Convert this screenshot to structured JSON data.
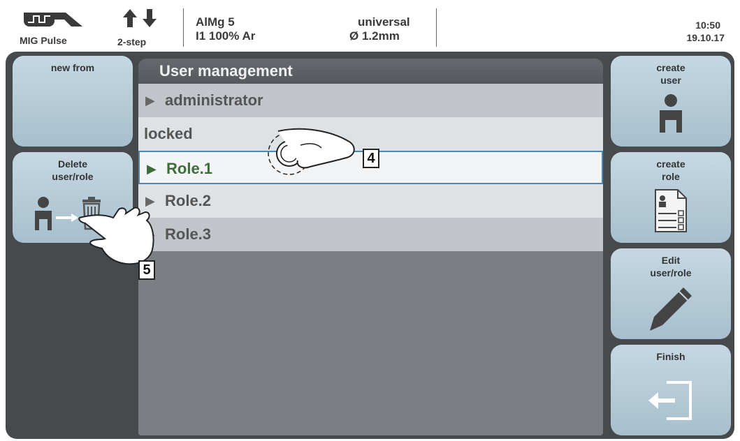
{
  "status": {
    "mode": "MIG Pulse",
    "trigger": "2-step",
    "material": "AlMg 5",
    "gas": "I1 100% Ar",
    "characteristic": "universal",
    "wire": "Ø  1.2mm",
    "time": "10:50",
    "date": "19.10.17"
  },
  "left_buttons": [
    {
      "label": "new from"
    },
    {
      "label_line1": "Delete",
      "label_line2": "user/role"
    }
  ],
  "right_buttons": [
    {
      "label_line1": "create",
      "label_line2": "user"
    },
    {
      "label_line1": "create",
      "label_line2": "role"
    },
    {
      "label_line1": "Edit",
      "label_line2": "user/role"
    },
    {
      "label": "Finish"
    }
  ],
  "panel": {
    "title": "User management",
    "rows": [
      {
        "text": "administrator"
      },
      {
        "text": "locked"
      },
      {
        "text": "Role.1"
      },
      {
        "text": "Role.2"
      },
      {
        "text": "Role.3"
      }
    ]
  },
  "callouts": [
    "4",
    "5"
  ],
  "icons": {
    "mode": "mig-pulse-icon",
    "trigger": "up-down-arrows-icon",
    "user": "user-icon",
    "role": "role-document-icon",
    "delete": "user-to-trash-icon",
    "edit": "pencil-icon",
    "finish": "exit-icon"
  }
}
